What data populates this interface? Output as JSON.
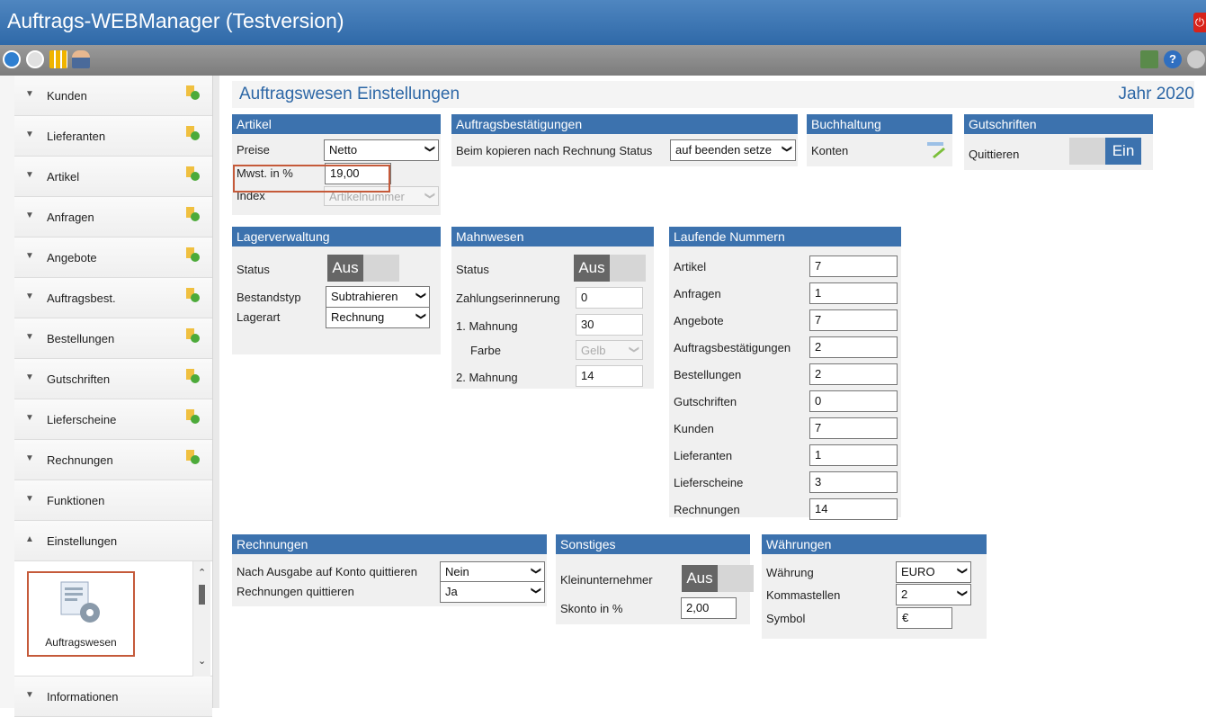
{
  "app_title": "Auftrags-WEBManager (Testversion)",
  "sidebar": {
    "items": [
      {
        "label": "Kunden",
        "has_add": true
      },
      {
        "label": "Lieferanten",
        "has_add": true
      },
      {
        "label": "Artikel",
        "has_add": true
      },
      {
        "label": "Anfragen",
        "has_add": true
      },
      {
        "label": "Angebote",
        "has_add": true
      },
      {
        "label": "Auftragsbest.",
        "has_add": true
      },
      {
        "label": "Bestellungen",
        "has_add": true
      },
      {
        "label": "Gutschriften",
        "has_add": true
      },
      {
        "label": "Lieferscheine",
        "has_add": true
      },
      {
        "label": "Rechnungen",
        "has_add": true
      },
      {
        "label": "Funktionen",
        "has_add": false
      },
      {
        "label": "Einstellungen",
        "has_add": false
      }
    ],
    "sub_tile_label": "Auftragswesen",
    "last_item": "Informationen"
  },
  "header": {
    "title": "Auftragswesen Einstellungen",
    "year": "Jahr 2020"
  },
  "artikel": {
    "title": "Artikel",
    "preise_label": "Preise",
    "preise_value": "Netto",
    "mwst_label": "Mwst. in %",
    "mwst_value": "19,00",
    "index_label": "Index",
    "index_value": "Artikelnummer"
  },
  "auftragsbest": {
    "title": "Auftragsbestätigungen",
    "label": "Beim kopieren nach Rechnung Status",
    "value": "auf beenden setze"
  },
  "buchhaltung": {
    "title": "Buchhaltung",
    "label": "Konten"
  },
  "gutschriften": {
    "title": "Gutschriften",
    "label": "Quittieren",
    "toggle": "Ein"
  },
  "lager": {
    "title": "Lagerverwaltung",
    "status_label": "Status",
    "status_toggle": "Aus",
    "bestandstyp_label": "Bestandstyp",
    "bestandstyp_value": "Subtrahieren",
    "lagerart_label": "Lagerart",
    "lagerart_value": "Rechnung"
  },
  "mahnwesen": {
    "title": "Mahnwesen",
    "status_label": "Status",
    "status_toggle": "Aus",
    "zahl_label": "Zahlungserinnerung",
    "zahl_value": "0",
    "m1_label": "1. Mahnung",
    "m1_value": "30",
    "farbe_label": "Farbe",
    "farbe_value": "Gelb",
    "m2_label": "2. Mahnung",
    "m2_value": "14"
  },
  "laufende": {
    "title": "Laufende Nummern",
    "rows": [
      {
        "label": "Artikel",
        "value": "7"
      },
      {
        "label": "Anfragen",
        "value": "1"
      },
      {
        "label": "Angebote",
        "value": "7"
      },
      {
        "label": "Auftragsbestätigungen",
        "value": "2"
      },
      {
        "label": "Bestellungen",
        "value": "2"
      },
      {
        "label": "Gutschriften",
        "value": "0"
      },
      {
        "label": "Kunden",
        "value": "7"
      },
      {
        "label": "Lieferanten",
        "value": "1"
      },
      {
        "label": "Lieferscheine",
        "value": "3"
      },
      {
        "label": "Rechnungen",
        "value": "14"
      }
    ]
  },
  "rechnungen": {
    "title": "Rechnungen",
    "q1_label": "Nach Ausgabe auf Konto quittieren",
    "q1_value": "Nein",
    "q2_label": "Rechnungen quittieren",
    "q2_value": "Ja"
  },
  "sonstiges": {
    "title": "Sonstiges",
    "klein_label": "Kleinunternehmer",
    "klein_toggle": "Aus",
    "skonto_label": "Skonto in %",
    "skonto_value": "2,00"
  },
  "waehrungen": {
    "title": "Währungen",
    "w_label": "Währung",
    "w_value": "EURO",
    "k_label": "Kommastellen",
    "k_value": "2",
    "s_label": "Symbol",
    "s_value": "€"
  }
}
